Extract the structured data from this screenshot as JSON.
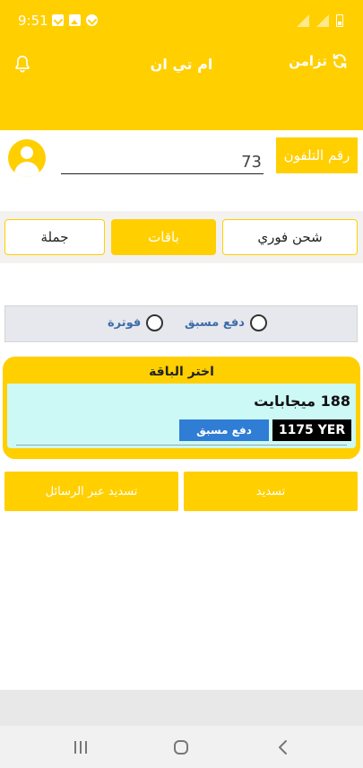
{
  "status_bar": {
    "time": "9:51"
  },
  "app_bar": {
    "title": "ام تي ان",
    "sync_label": "تزامن"
  },
  "phone": {
    "value": "73",
    "label": "رقم التلفون"
  },
  "tabs": [
    {
      "label": "شحن فوري"
    },
    {
      "label": "باقات"
    },
    {
      "label": "جملة"
    }
  ],
  "payment_type": {
    "options": [
      {
        "label": "دفع مسبق"
      },
      {
        "label": "فوترة"
      }
    ]
  },
  "package": {
    "header": "اختر الباقة",
    "name": "188 ميجابايت",
    "price": "1175 YER",
    "type": "دفع مسبق"
  },
  "actions": {
    "pay_label": "تسديد",
    "sms_label": "تسديد عبر الرسائل"
  },
  "colors": {
    "accent": "#ffcf00",
    "badge_blue": "#2f7dd4",
    "package_bg": "#ccf8f6"
  },
  "icons": {
    "bell": "bell-icon",
    "sync": "sync-icon",
    "avatar": "user-avatar-icon"
  }
}
